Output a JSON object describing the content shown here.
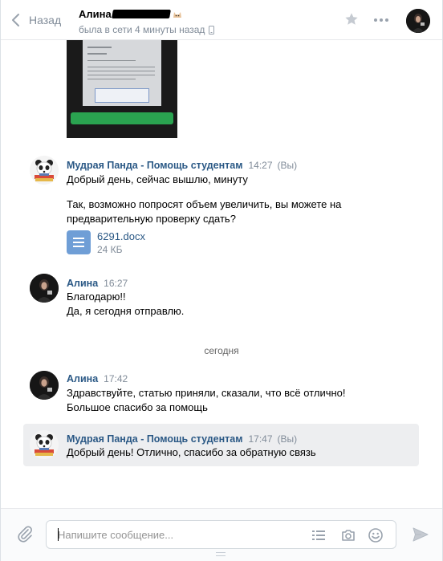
{
  "header": {
    "back_label": "Назад",
    "peer_name": "Алина",
    "peer_status": "была в сети 4 минуты назад"
  },
  "messages": [
    {
      "author": "Мудрая Панда - Помощь студентам",
      "time": "14:27",
      "you": "(Вы)",
      "lines": [
        "Добрый день, сейчас вышлю, минуту"
      ],
      "lines2": [
        "Так, возможно попросят объем увеличить, вы можете на",
        "предварительную проверку сдать?"
      ],
      "attachment": {
        "name": "6291.docx",
        "size": "24 КБ"
      }
    },
    {
      "author": "Алина",
      "time": "16:27",
      "lines": [
        "Благодарю!!",
        "Да, я сегодня отправлю."
      ]
    },
    {
      "author": "Алина",
      "time": "17:42",
      "lines": [
        "Здравствуйте, статью приняли, сказали, что всё отлично!",
        "Большое спасибо за помощь"
      ]
    },
    {
      "author": "Мудрая Панда - Помощь студентам",
      "time": "17:47",
      "you": "(Вы)",
      "lines": [
        "Добрый день! Отлично, спасибо за обратную связь"
      ]
    }
  ],
  "date_separator": "сегодня",
  "composer": {
    "placeholder": "Напишите сообщение..."
  },
  "colors": {
    "link": "#2a5885",
    "muted": "#818c99",
    "highlight_bg": "#edeef0",
    "doc_icon": "#6f9ed6"
  }
}
